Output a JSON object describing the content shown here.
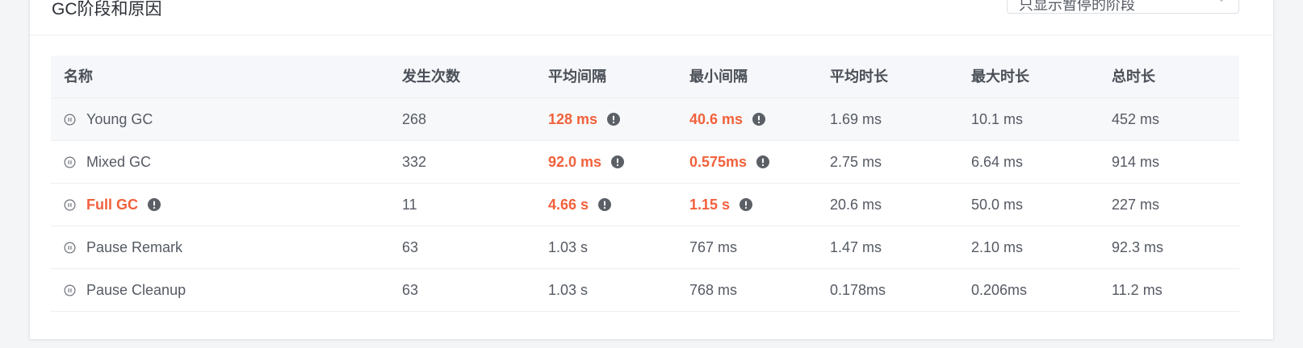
{
  "card": {
    "title": "GC阶段和原因",
    "filter_select": {
      "value": "只显示暂停的阶段",
      "icon": "chevron-down-icon"
    }
  },
  "table": {
    "columns": [
      "名称",
      "发生次数",
      "平均间隔",
      "最小间隔",
      "平均时长",
      "最大时长",
      "总时长"
    ],
    "rows": [
      {
        "name": "Young GC",
        "count": "268",
        "avg_interval": "128 ms",
        "min_interval": "40.6 ms",
        "avg_duration": "1.69 ms",
        "max_duration": "10.1 ms",
        "total": "452 ms"
      },
      {
        "name": "Mixed GC",
        "count": "332",
        "avg_interval": "92.0 ms",
        "min_interval": "0.575ms",
        "avg_duration": "2.75 ms",
        "max_duration": "6.64 ms",
        "total": "914 ms"
      },
      {
        "name": "Full GC",
        "count": "11",
        "avg_interval": "4.66 s",
        "min_interval": "1.15 s",
        "avg_duration": "20.6 ms",
        "max_duration": "50.0 ms",
        "total": "227 ms"
      },
      {
        "name": "Pause Remark",
        "count": "63",
        "avg_interval": "1.03 s",
        "min_interval": "767 ms",
        "avg_duration": "1.47 ms",
        "max_duration": "2.10 ms",
        "total": "92.3 ms"
      },
      {
        "name": "Pause Cleanup",
        "count": "63",
        "avg_interval": "1.03 s",
        "min_interval": "768 ms",
        "avg_duration": "0.178ms",
        "max_duration": "0.206ms",
        "total": "11.2 ms"
      }
    ]
  },
  "icons": {
    "phase": "pause-circle-icon",
    "alert": "exclamation-circle-icon"
  },
  "colors": {
    "warning": "#f1613c",
    "header_bg": "#f5f7fa",
    "stripe_bg": "#f7f8fa",
    "icon_dark": "#5b5f66"
  }
}
